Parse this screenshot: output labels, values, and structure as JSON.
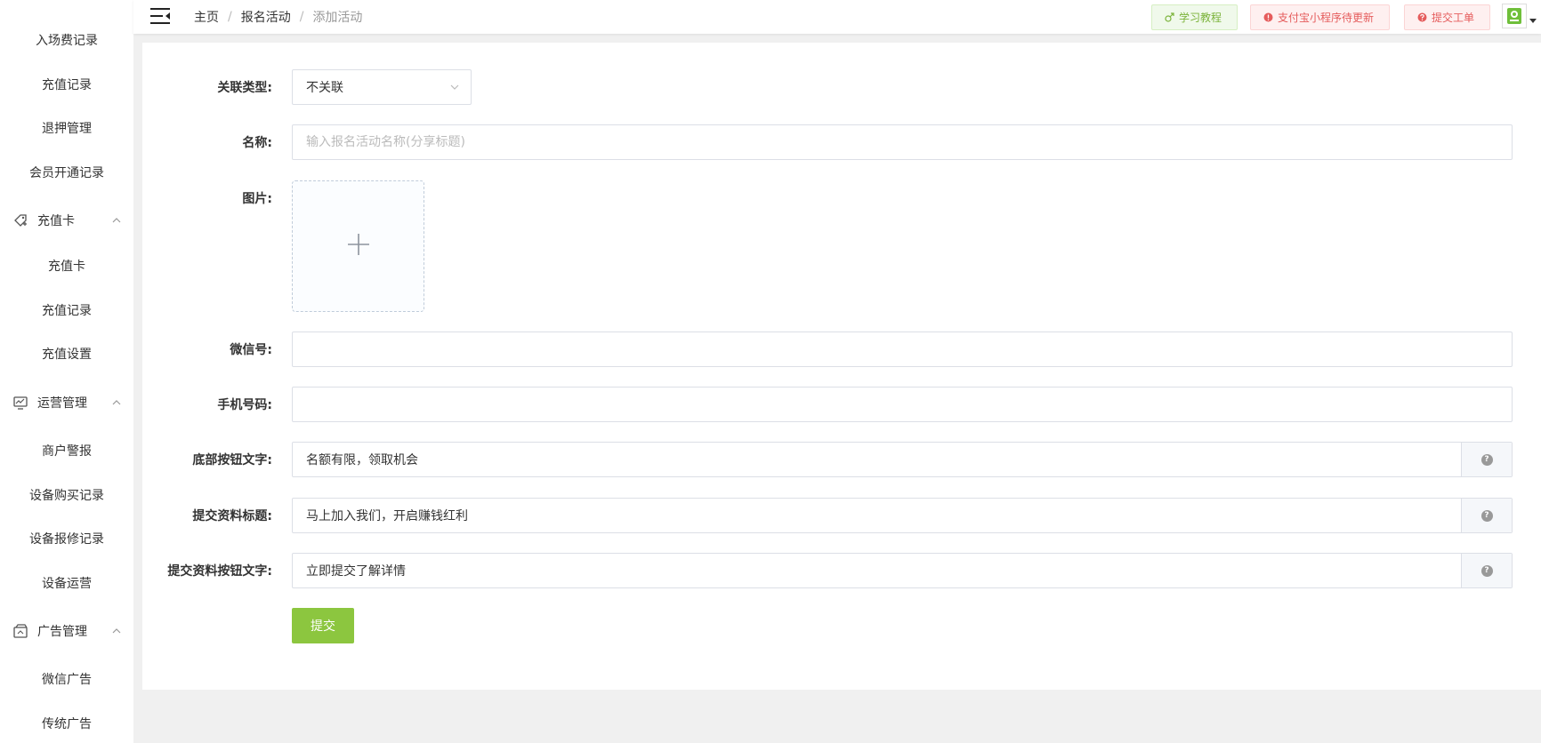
{
  "sidebar": {
    "top_items": [
      "入场费记录",
      "充值记录",
      "退押管理",
      "会员开通记录"
    ],
    "groups": [
      {
        "label": "充值卡",
        "icon": "tag-icon",
        "items": [
          "充值卡",
          "充值记录",
          "充值设置"
        ]
      },
      {
        "label": "运营管理",
        "icon": "monitor-chart-icon",
        "items": [
          "商户警报",
          "设备购买记录",
          "设备报修记录",
          "设备运营"
        ]
      },
      {
        "label": "广告管理",
        "icon": "ad-card-icon",
        "items": [
          "微信广告",
          "传统广告"
        ]
      }
    ]
  },
  "header": {
    "breadcrumb": [
      "主页",
      "报名活动",
      "添加活动"
    ],
    "buttons": {
      "tutorial": "学习教程",
      "alipay_update": "支付宝小程序待更新",
      "submit_ticket": "提交工单"
    },
    "colors": {
      "green": "#7bb33a",
      "red": "#e55c5c"
    }
  },
  "form": {
    "relation_type": {
      "label": "关联类型:",
      "value": "不关联"
    },
    "name": {
      "label": "名称:",
      "placeholder": "输入报名活动名称(分享标题)"
    },
    "image": {
      "label": "图片:"
    },
    "wechat": {
      "label": "微信号:",
      "value": ""
    },
    "phone": {
      "label": "手机号码:",
      "value": ""
    },
    "bottom_button_text": {
      "label": "底部按钮文字:",
      "value": "名额有限，领取机会"
    },
    "submit_title": {
      "label": "提交资料标题:",
      "value": "马上加入我们，开启赚钱红利"
    },
    "submit_button_text": {
      "label": "提交资料按钮文字:",
      "value": "立即提交了解详情"
    },
    "submit_label": "提交",
    "accent_color": "#8cc63f"
  }
}
